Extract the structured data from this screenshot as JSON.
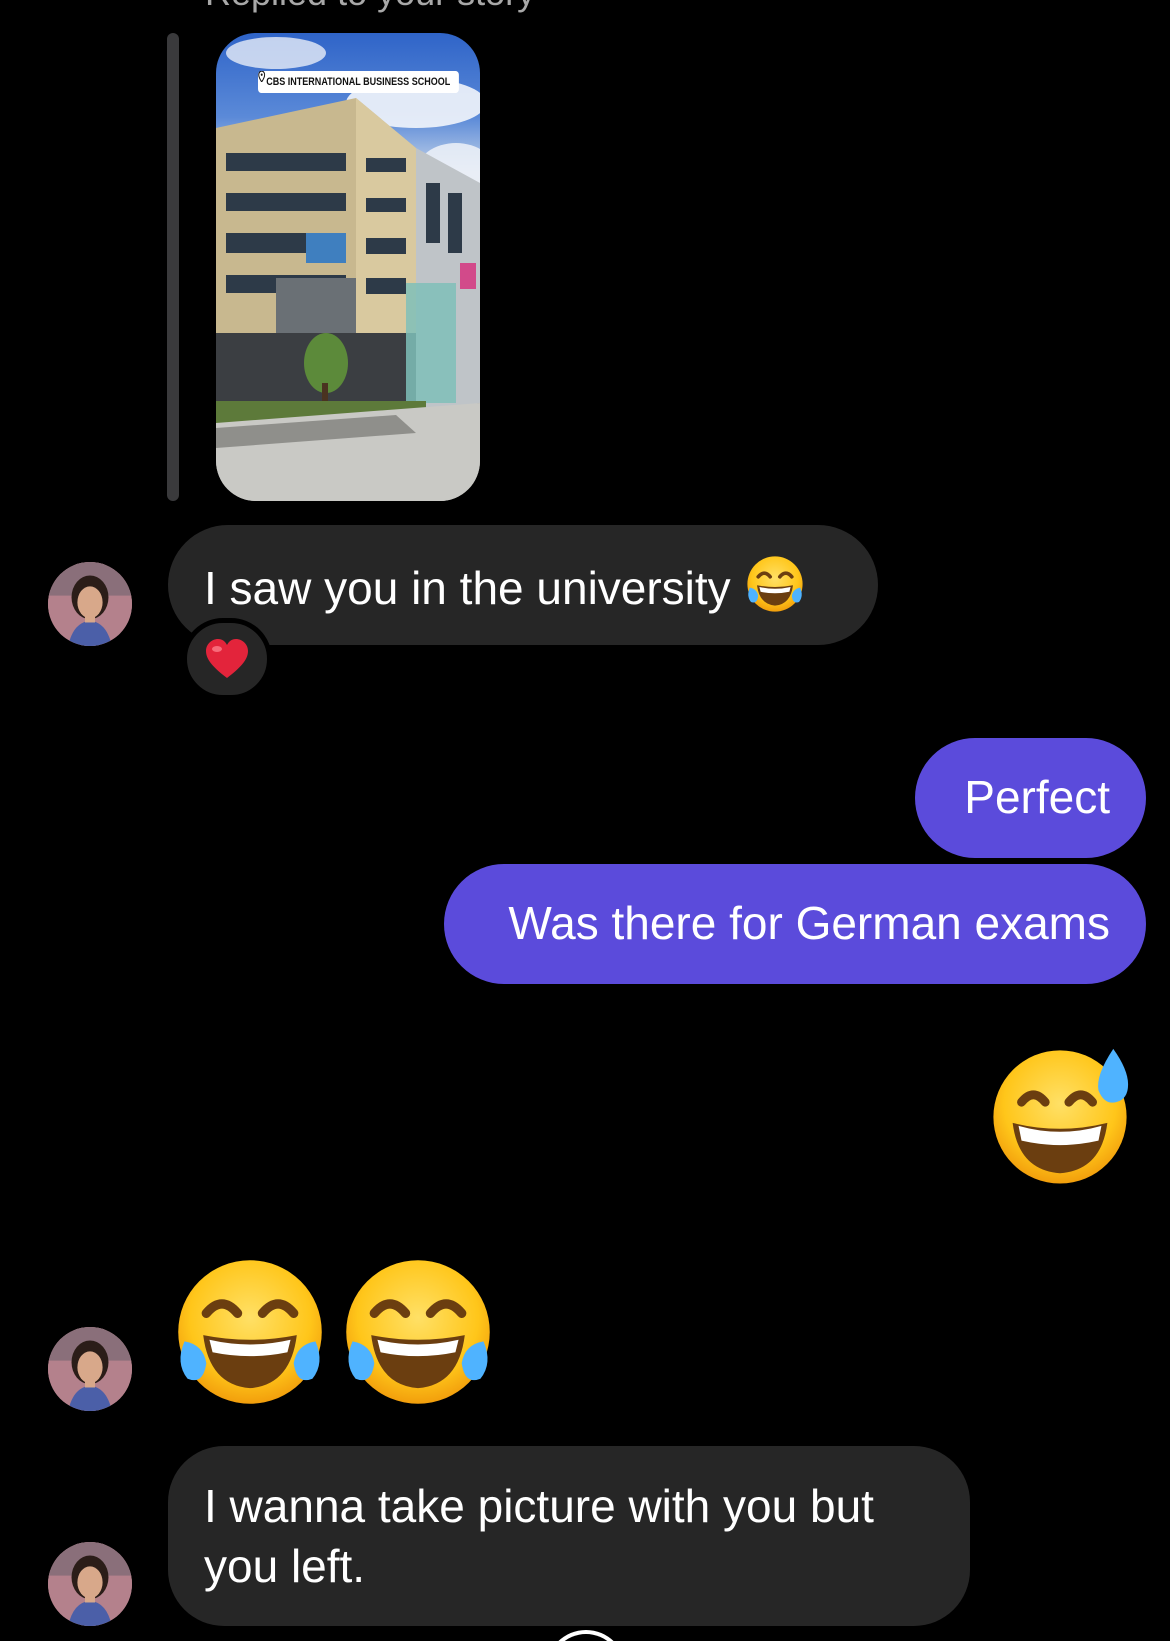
{
  "story_reply": {
    "caption": "Replied to your story",
    "location_sticker": "CBS INTERNATIONAL BUSINESS SCHOOL"
  },
  "messages": [
    {
      "from": "them",
      "text": "I saw you in the university",
      "emoji": "face-with-tears-of-joy",
      "reaction": "red-heart"
    },
    {
      "from": "me",
      "text": "Perfect"
    },
    {
      "from": "me",
      "text": "Was there for German exams"
    },
    {
      "from": "me",
      "emoji": "grinning-face-with-sweat"
    },
    {
      "from": "them",
      "emoji": "face-with-tears-of-joy x2"
    },
    {
      "from": "them",
      "text": "I wanna take picture with you but you left."
    }
  ],
  "colors": {
    "background": "#000000",
    "received_bubble": "#262626",
    "sent_bubble": "#5b4bdb",
    "caption": "#a8a8a8"
  }
}
